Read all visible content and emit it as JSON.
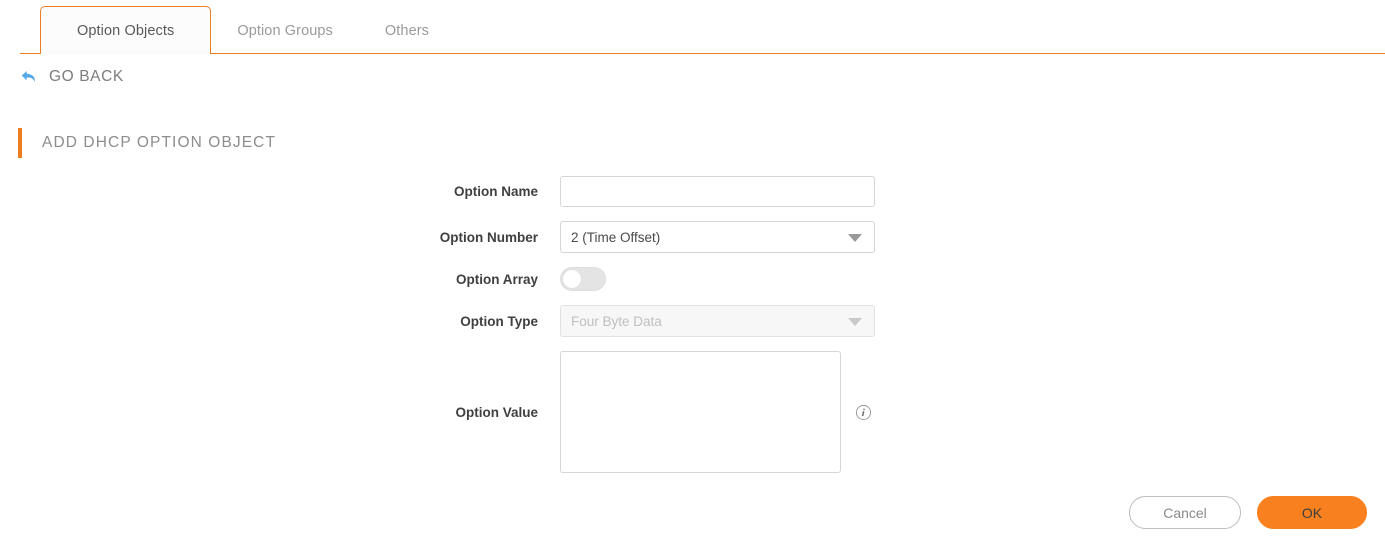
{
  "tabs": [
    {
      "label": "Option Objects",
      "active": true
    },
    {
      "label": "Option Groups",
      "active": false
    },
    {
      "label": "Others",
      "active": false
    }
  ],
  "goback": {
    "label": "GO BACK",
    "icon": "back-arrow-icon"
  },
  "section": {
    "title": "ADD DHCP OPTION OBJECT",
    "accent_color": "#ec7e22"
  },
  "form": {
    "option_name": {
      "label": "Option Name",
      "value": "",
      "placeholder": ""
    },
    "option_number": {
      "label": "Option Number",
      "value": "2 (Time Offset)"
    },
    "option_array": {
      "label": "Option Array",
      "state": "off"
    },
    "option_type": {
      "label": "Option Type",
      "value": "Four Byte Data",
      "disabled": true
    },
    "option_value": {
      "label": "Option Value",
      "value": "",
      "placeholder": "",
      "info_icon": "info-icon"
    }
  },
  "footer": {
    "cancel_label": "Cancel",
    "ok_label": "OK",
    "ok_color": "#f9801f"
  }
}
